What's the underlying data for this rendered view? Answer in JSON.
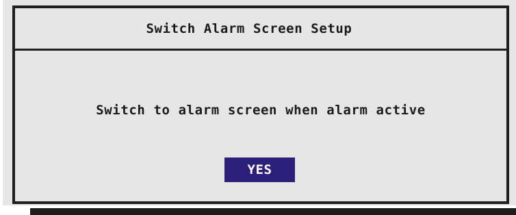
{
  "dialog": {
    "title": "Switch Alarm Screen Setup",
    "message": "Switch to alarm screen when alarm active",
    "button_label": "YES"
  },
  "colors": {
    "background": "#e6e6e6",
    "border": "#1f1f1f",
    "button_bg": "#2b1f7a",
    "button_text": "#ffffff",
    "text": "#1a1a1a"
  }
}
